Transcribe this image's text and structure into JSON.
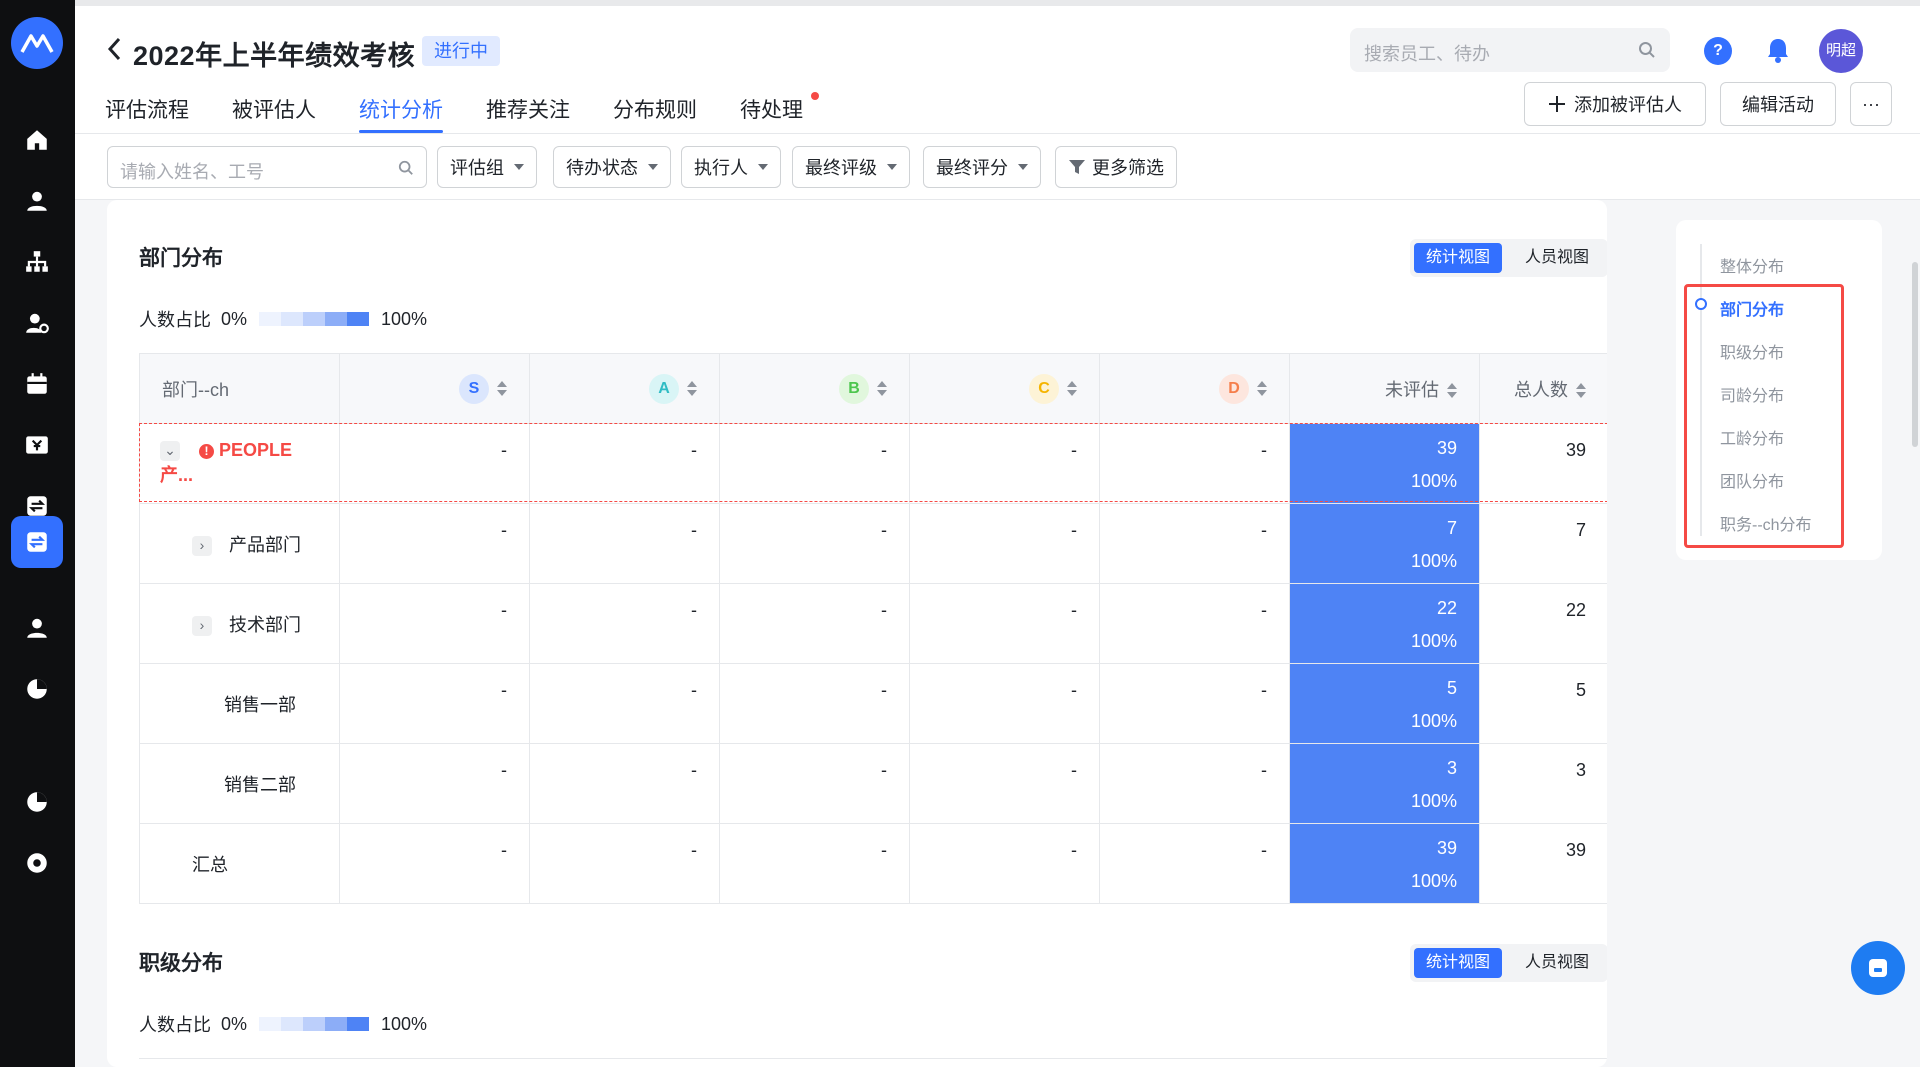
{
  "rail": {
    "items": [
      "home",
      "person",
      "org",
      "person-settings",
      "calendar",
      "payroll",
      "exchange",
      "performance",
      "profile",
      "analytics",
      "pie",
      "settings"
    ],
    "active": "performance"
  },
  "header": {
    "title": "2022年上半年绩效考核",
    "status": "进行中",
    "search_placeholder": "搜索员工、待办",
    "help": "?",
    "avatar_text": "明超",
    "tabs": [
      {
        "label": "评估流程"
      },
      {
        "label": "被评估人"
      },
      {
        "label": "统计分析"
      },
      {
        "label": "推荐关注"
      },
      {
        "label": "分布规则"
      },
      {
        "label": "待处理"
      }
    ],
    "active_tab": "统计分析",
    "add_button": "添加被评估人",
    "edit_button": "编辑活动",
    "more_button": "···"
  },
  "filters": {
    "name_placeholder": "请输入姓名、工号",
    "dropdowns": [
      "评估组",
      "待办状态",
      "执行人",
      "最终评级",
      "最终评分"
    ],
    "more": "更多筛选"
  },
  "dept_section": {
    "title": "部门分布",
    "view_stat": "统计视图",
    "view_people": "人员视图",
    "ratio_label": "人数占比",
    "ratio_min": "0%",
    "ratio_max": "100%",
    "legend_colors": [
      "#eef3fe",
      "#dde7fd",
      "#bccffb",
      "#8cadf7",
      "#4e83f5"
    ],
    "columns": {
      "dept": "部门--ch",
      "grades": [
        {
          "label": "S",
          "bg": "#dbe6fd",
          "fg": "#3370ff"
        },
        {
          "label": "A",
          "bg": "#d9f5f6",
          "fg": "#2fbcc4"
        },
        {
          "label": "B",
          "bg": "#e1f7dd",
          "fg": "#4cc64d"
        },
        {
          "label": "C",
          "bg": "#fdf3d6",
          "fg": "#f5b400"
        },
        {
          "label": "D",
          "bg": "#fde6de",
          "fg": "#f57e4b"
        }
      ],
      "unrated": "未评估",
      "total": "总人数"
    },
    "rows": [
      {
        "name": "PEOPLE产...",
        "S": "-",
        "A": "-",
        "B": "-",
        "C": "-",
        "D": "-",
        "unrated": "39",
        "unrated_pct": "100%",
        "total": "39"
      },
      {
        "name": "产品部门",
        "S": "-",
        "A": "-",
        "B": "-",
        "C": "-",
        "D": "-",
        "unrated": "7",
        "unrated_pct": "100%",
        "total": "7"
      },
      {
        "name": "技术部门",
        "S": "-",
        "A": "-",
        "B": "-",
        "C": "-",
        "D": "-",
        "unrated": "22",
        "unrated_pct": "100%",
        "total": "22"
      },
      {
        "name": "销售一部",
        "S": "-",
        "A": "-",
        "B": "-",
        "C": "-",
        "D": "-",
        "unrated": "5",
        "unrated_pct": "100%",
        "total": "5"
      },
      {
        "name": "销售二部",
        "S": "-",
        "A": "-",
        "B": "-",
        "C": "-",
        "D": "-",
        "unrated": "3",
        "unrated_pct": "100%",
        "total": "3"
      },
      {
        "name": "汇总",
        "S": "-",
        "A": "-",
        "B": "-",
        "C": "-",
        "D": "-",
        "unrated": "39",
        "unrated_pct": "100%",
        "total": "39"
      }
    ]
  },
  "level_section": {
    "title": "职级分布",
    "view_stat": "统计视图",
    "view_people": "人员视图",
    "ratio_label": "人数占比",
    "ratio_min": "0%",
    "ratio_max": "100%"
  },
  "anchor": {
    "items": [
      "整体分布",
      "部门分布",
      "职级分布",
      "司龄分布",
      "工龄分布",
      "团队分布",
      "职务--ch分布"
    ],
    "active": "部门分布"
  }
}
